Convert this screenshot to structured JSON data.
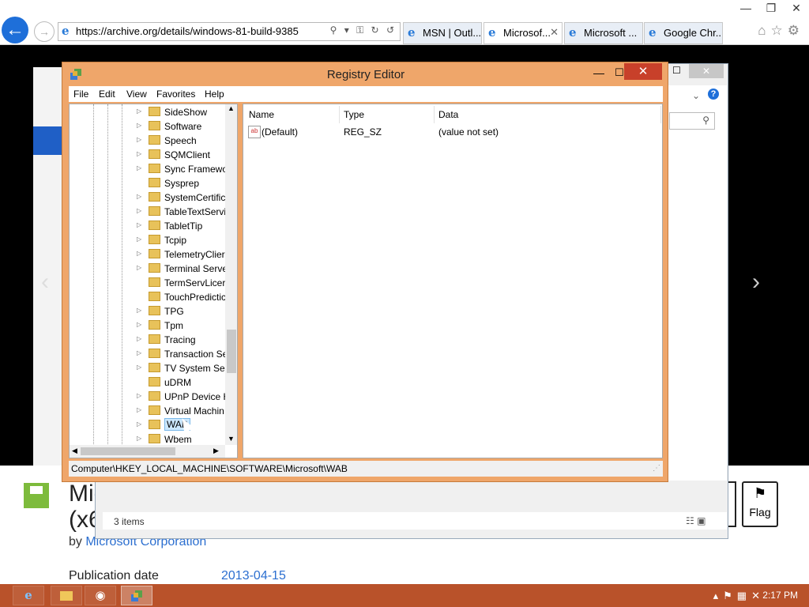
{
  "browser": {
    "url": "https://archive.org/details/windows-81-build-9385",
    "tabs": [
      {
        "label": "MSN | Outl...",
        "active": false
      },
      {
        "label": "Microsof...",
        "active": true
      },
      {
        "label": "Microsoft ...",
        "active": false
      },
      {
        "label": "Google Chr...",
        "active": false
      }
    ],
    "window_controls": [
      "—",
      "❐",
      "✕"
    ]
  },
  "page": {
    "title": "Mic\n(x6",
    "by_prefix": "by ",
    "by_author": "Microsoft Corporation",
    "pub_label": "Publication date",
    "pub_value": "2013-04-15",
    "flag_label": "Flag",
    "other_btn_label": "e"
  },
  "explorer": {
    "items_count": "3 items"
  },
  "regedit": {
    "title": "Registry Editor",
    "menu": [
      "File",
      "Edit",
      "View",
      "Favorites",
      "Help"
    ],
    "tree_items": [
      "SideShow",
      "Software",
      "Speech",
      "SQMClient",
      "Sync Framewo",
      "Sysprep",
      "SystemCertific",
      "TableTextServi",
      "TabletTip",
      "Tcpip",
      "TelemetryClier",
      "Terminal Serve",
      "TermServLicer",
      "TouchPredictic",
      "TPG",
      "Tpm",
      "Tracing",
      "Transaction Se",
      "TV System Ser",
      "uDRM",
      "UPnP Device H",
      "Virtual Machin",
      "WAB",
      "Wbem"
    ],
    "selected": "WAB",
    "columns": [
      "Name",
      "Type",
      "Data"
    ],
    "values": [
      {
        "name": "(Default)",
        "type": "REG_SZ",
        "data": "(value not set)"
      }
    ],
    "status_path": "Computer\\HKEY_LOCAL_MACHINE\\SOFTWARE\\Microsoft\\WAB"
  },
  "taskbar": {
    "time": "2:17 PM"
  },
  "colors": {
    "regedit_frame": "#efa66a",
    "close_button": "#c8402a",
    "taskbar": "#b9522a",
    "link": "#2c6fd0"
  }
}
